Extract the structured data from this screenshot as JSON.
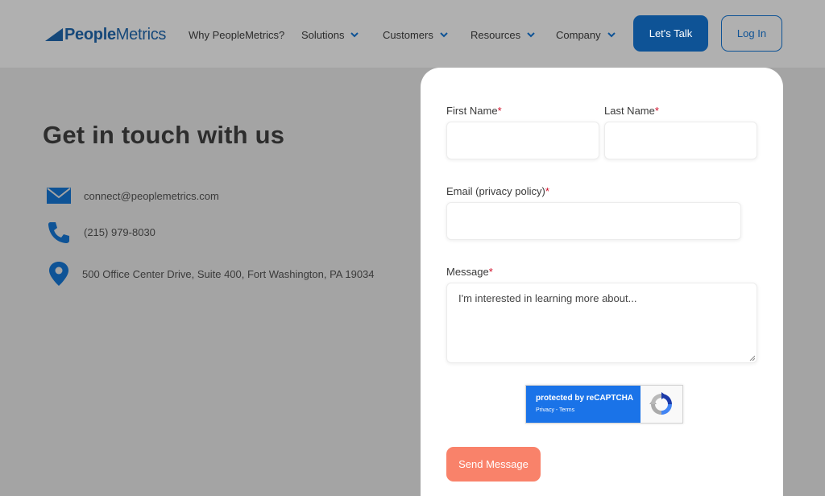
{
  "header": {
    "logo_bold": "People",
    "logo_light": "Metrics",
    "nav": [
      {
        "label": "Why PeopleMetrics?",
        "has_dropdown": false
      },
      {
        "label": "Solutions",
        "has_dropdown": true
      },
      {
        "label": "Customers",
        "has_dropdown": true
      },
      {
        "label": "Resources",
        "has_dropdown": true
      },
      {
        "label": "Company",
        "has_dropdown": true
      }
    ],
    "cta_label": "Let's Talk",
    "login_label": "Log In"
  },
  "contact": {
    "title": "Get in touch with us",
    "email": "connect@peoplemetrics.com",
    "phone": "(215) 979-8030",
    "address": "500 Office Center Drive, Suite 400, Fort Washington, PA 19034",
    "icons": [
      "envelope-icon",
      "phone-icon",
      "map-pin-icon"
    ]
  },
  "form": {
    "first_name_label": "First Name",
    "last_name_label": "Last Name",
    "email_label": "Email (privacy policy)",
    "message_label": "Message",
    "required_mark": "*",
    "first_name_value": "",
    "last_name_value": "",
    "email_value": "",
    "message_placeholder": "I'm interested in learning more about...",
    "recaptcha_title": "protected by reCAPTCHA",
    "recaptcha_links": "Privacy - Terms",
    "submit_label": "Send Message"
  },
  "colors": {
    "brand_blue": "#0e5396",
    "submit_coral": "#f9826a",
    "required_red": "#d0112b",
    "recaptcha_blue": "#1a73e8"
  }
}
